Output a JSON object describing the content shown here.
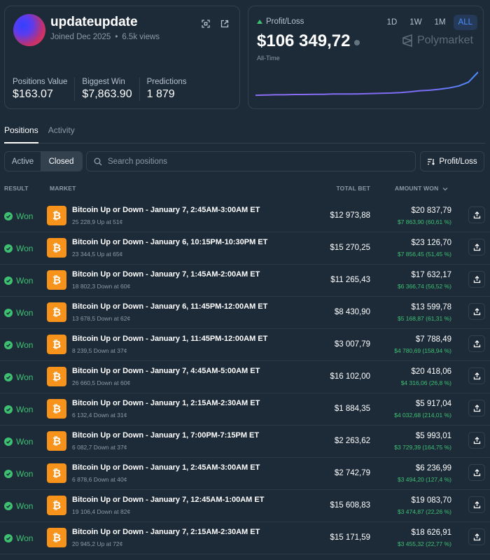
{
  "profile": {
    "username": "updateupdate",
    "joined": "Joined Dec 2025",
    "views": "6.5k views",
    "stats": [
      {
        "label": "Positions Value",
        "value": "$163.07"
      },
      {
        "label": "Biggest Win",
        "value": "$7,863.90"
      },
      {
        "label": "Predictions",
        "value": "1 879"
      }
    ]
  },
  "pnl": {
    "label": "Profit/Loss",
    "value": "$106 349,72",
    "period": "All-Time",
    "brand": "Polymarket",
    "ranges": [
      "1D",
      "1W",
      "1M",
      "ALL"
    ],
    "active_range": "ALL",
    "accent": "#4d8dff",
    "sparkline": [
      0.08,
      0.09,
      0.1,
      0.1,
      0.11,
      0.11,
      0.12,
      0.12,
      0.13,
      0.13,
      0.13,
      0.14,
      0.15,
      0.16,
      0.17,
      0.19,
      0.22,
      0.26,
      0.28,
      0.32,
      0.37,
      0.45,
      0.6,
      1.0
    ]
  },
  "tabs": [
    "Positions",
    "Activity"
  ],
  "filters": {
    "active": "Active",
    "closed": "Closed",
    "selected": "Closed"
  },
  "search": {
    "placeholder": "Search positions",
    "value": ""
  },
  "sort": {
    "label": "Profit/Loss"
  },
  "columns": {
    "result": "RESULT",
    "market": "MARKET",
    "total_bet": "TOTAL BET",
    "amount_won": "AMOUNT WON"
  },
  "positions": [
    {
      "result": "Won",
      "title": "Bitcoin Up or Down - January 7, 2:45AM-3:00AM ET",
      "sub": "25 228,9 Up at 51¢",
      "bet": "$12 973,88",
      "won": "$20 837,79",
      "profit": "$7 863,90 (60,61 %)"
    },
    {
      "result": "Won",
      "title": "Bitcoin Up or Down - January 6, 10:15PM-10:30PM ET",
      "sub": "23 344,5 Up at 65¢",
      "bet": "$15 270,25",
      "won": "$23 126,70",
      "profit": "$7 856,45 (51,45 %)"
    },
    {
      "result": "Won",
      "title": "Bitcoin Up or Down - January 7, 1:45AM-2:00AM ET",
      "sub": "18 802,3 Down at 60¢",
      "bet": "$11 265,43",
      "won": "$17 632,17",
      "profit": "$6 366,74 (56,52 %)"
    },
    {
      "result": "Won",
      "title": "Bitcoin Up or Down - January 6, 11:45PM-12:00AM ET",
      "sub": "13 678,5 Down at 62¢",
      "bet": "$8 430,90",
      "won": "$13 599,78",
      "profit": "$5 168,87 (61,31 %)"
    },
    {
      "result": "Won",
      "title": "Bitcoin Up or Down - January 1, 11:45PM-12:00AM ET",
      "sub": "8 239,5 Down at 37¢",
      "bet": "$3 007,79",
      "won": "$7 788,49",
      "profit": "$4 780,69 (158,94 %)"
    },
    {
      "result": "Won",
      "title": "Bitcoin Up or Down - January 7, 4:45AM-5:00AM ET",
      "sub": "26 660,5 Down at 60¢",
      "bet": "$16 102,00",
      "won": "$20 418,06",
      "profit": "$4 316,06 (26,8 %)"
    },
    {
      "result": "Won",
      "title": "Bitcoin Up or Down - January 1, 2:15AM-2:30AM ET",
      "sub": "6 132,4 Down at 31¢",
      "bet": "$1 884,35",
      "won": "$5 917,04",
      "profit": "$4 032,68 (214,01 %)"
    },
    {
      "result": "Won",
      "title": "Bitcoin Up or Down - January 1, 7:00PM-7:15PM ET",
      "sub": "6 082,7 Down at 37¢",
      "bet": "$2 263,62",
      "won": "$5 993,01",
      "profit": "$3 729,39 (164,75 %)"
    },
    {
      "result": "Won",
      "title": "Bitcoin Up or Down - January 1, 2:45AM-3:00AM ET",
      "sub": "6 878,6 Down at 40¢",
      "bet": "$2 742,79",
      "won": "$6 236,99",
      "profit": "$3 494,20 (127,4 %)"
    },
    {
      "result": "Won",
      "title": "Bitcoin Up or Down - January 7, 12:45AM-1:00AM ET",
      "sub": "19 106,4 Down at 82¢",
      "bet": "$15 608,83",
      "won": "$19 083,70",
      "profit": "$3 474,87 (22,26 %)"
    },
    {
      "result": "Won",
      "title": "Bitcoin Up or Down - January 7, 2:15AM-2:30AM ET",
      "sub": "20 945,2 Up at 72¢",
      "bet": "$15 171,59",
      "won": "$18 626,91",
      "profit": "$3 455,32 (22,77 %)"
    },
    {
      "result": "",
      "title": "",
      "sub": "",
      "bet": "",
      "won": "",
      "profit": ""
    }
  ],
  "icons": {
    "coin": "bitcoin-icon",
    "share": "share-icon",
    "check": "check-circle-icon",
    "qr": "qr-icon",
    "external": "external-link-icon"
  },
  "colors": {
    "background": "#1d2b39",
    "positive": "#3ec071",
    "bitcoin": "#f7931a",
    "sparkline": "#8b6cf0"
  }
}
